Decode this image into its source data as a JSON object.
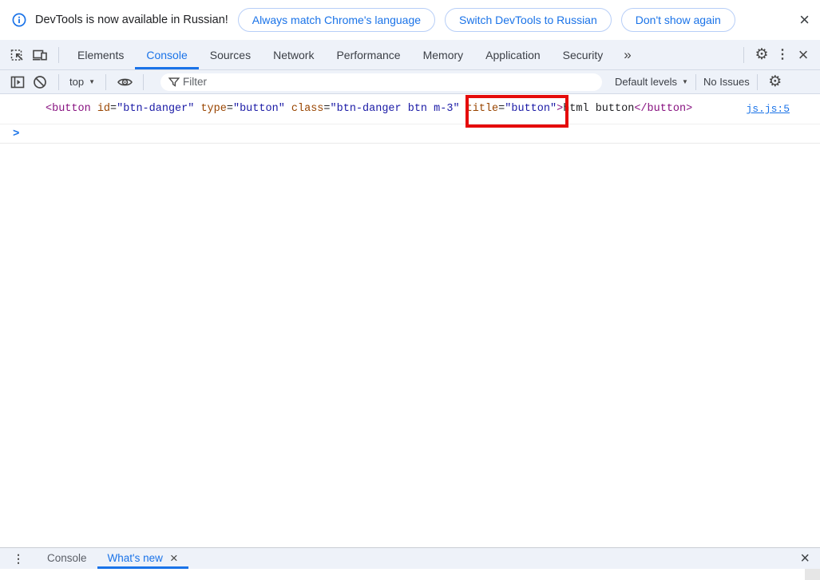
{
  "colors": {
    "accent": "#1a73e8",
    "toolbar_bg": "#eef2f9",
    "icon_gray": "#474747",
    "highlight_red": "#e50b0b",
    "syntax_tag": "#881280",
    "syntax_attr": "#994500",
    "syntax_value": "#1a1aa6",
    "link_blue": "#1a73e8"
  },
  "icons": {
    "dropdown": "▼",
    "more_tabs": "»",
    "close": "×",
    "kebab": "⋮",
    "gear": "⚙",
    "prompt": ">"
  },
  "notification_bar": {
    "message": "DevTools is now available in Russian!",
    "buttons": [
      {
        "label": "Always match Chrome's language"
      },
      {
        "label": "Switch DevTools to Russian"
      },
      {
        "label": "Don't show again"
      }
    ]
  },
  "main_toolbar": {
    "tabs": [
      {
        "label": "Elements",
        "active": false
      },
      {
        "label": "Console",
        "active": true
      },
      {
        "label": "Sources",
        "active": false
      },
      {
        "label": "Network",
        "active": false
      },
      {
        "label": "Performance",
        "active": false
      },
      {
        "label": "Memory",
        "active": false
      },
      {
        "label": "Application",
        "active": false
      },
      {
        "label": "Security",
        "active": false
      }
    ]
  },
  "console_toolbar": {
    "context_selector": "top",
    "filter_placeholder": "Filter",
    "levels_dropdown": "Default levels",
    "issues_label": "No Issues"
  },
  "console": {
    "message": {
      "tokens": [
        {
          "type": "tag",
          "text": "<button"
        },
        {
          "type": "attr",
          "text": " id"
        },
        {
          "type": "eq",
          "text": "="
        },
        {
          "type": "val",
          "text": "\"btn-danger\""
        },
        {
          "type": "attr",
          "text": " type"
        },
        {
          "type": "eq",
          "text": "="
        },
        {
          "type": "val",
          "text": "\"button\""
        },
        {
          "type": "attr",
          "text": " class"
        },
        {
          "type": "eq",
          "text": "="
        },
        {
          "type": "val",
          "text": "\"btn-danger btn m-3\""
        },
        {
          "type": "attr",
          "text": " title"
        },
        {
          "type": "eq",
          "text": "="
        },
        {
          "type": "val",
          "text": "\"button\""
        },
        {
          "type": "tag",
          "text": ">"
        },
        {
          "type": "text",
          "text": "html button"
        },
        {
          "type": "tag",
          "text": "</button>"
        }
      ]
    },
    "source_link": "js.js:5"
  },
  "drawer": {
    "tabs": [
      {
        "label": "Console",
        "active": false
      },
      {
        "label": "What's new",
        "active": true
      }
    ]
  }
}
